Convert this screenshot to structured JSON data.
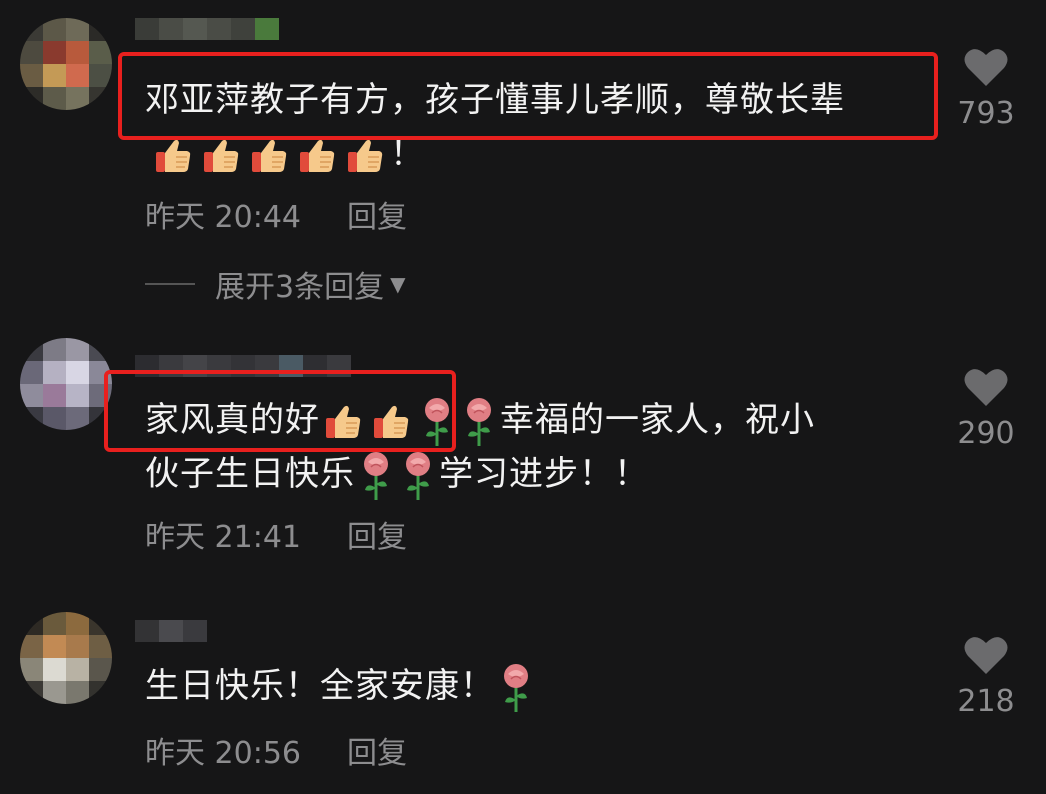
{
  "comments": [
    {
      "line1": "邓亚萍教子有方，孩子懂事儿孝顺，尊敬长辈",
      "line2_end": "！",
      "time": "昨天 20:44",
      "reply": "回复",
      "likes": "793",
      "expand": "展开3条回复"
    },
    {
      "line1_a": "家风真的好",
      "line1_b": "幸福的一家人，祝小",
      "line2_a": "伙子生日快乐",
      "line2_b": "学习进步！！",
      "time": "昨天 21:41",
      "reply": "回复",
      "likes": "290"
    },
    {
      "line1_a": "生日快乐！全家安康！",
      "time": "昨天 20:56",
      "reply": "回复",
      "likes": "218"
    }
  ],
  "icons": [
    "heart-icon",
    "thumbs-up-emoji",
    "rose-emoji",
    "triangle-down-icon"
  ],
  "colors": {
    "background": "#161617",
    "text": "#f2f2f2",
    "muted": "#8d8d8f",
    "highlight": "#e8201e"
  }
}
